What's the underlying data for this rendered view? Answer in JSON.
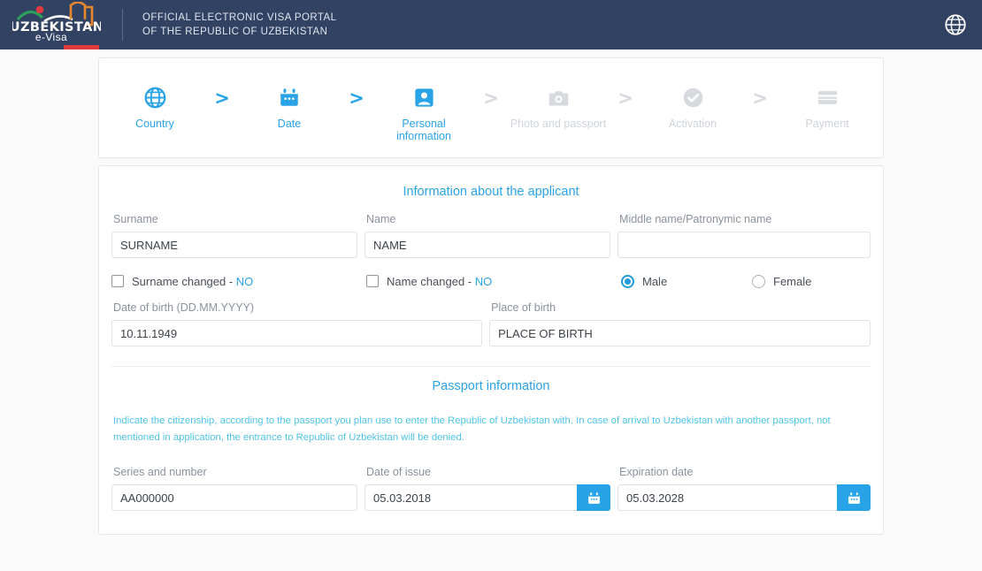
{
  "header": {
    "logo_text": "UZBEKISTAN",
    "logo_sub": "e-Visa",
    "title_line1": "OFFICIAL ELECTRONIC VISA PORTAL",
    "title_line2": "OF THE REPUBLIC OF UZBEKISTAN",
    "language_icon": "globe-icon",
    "bg_color": "#314263",
    "accent_red": "#e03a40"
  },
  "stepper": {
    "accent_color": "#29a3e8",
    "inactive_color": "#cfd4d9",
    "chevron": ">",
    "steps": [
      {
        "label": "Country",
        "icon": "globe-icon",
        "state": "active"
      },
      {
        "label": "Date",
        "icon": "calendar-icon",
        "state": "active"
      },
      {
        "label": "Personal\ninformation",
        "label_line1": "Personal",
        "label_line2": "information",
        "icon": "person-card-icon",
        "state": "current"
      },
      {
        "label": "Photo and passport",
        "icon": "camera-icon",
        "state": "inactive"
      },
      {
        "label": "Activation",
        "icon": "check-circle-icon",
        "state": "inactive"
      },
      {
        "label": "Payment",
        "icon": "credit-card-icon",
        "state": "inactive"
      }
    ]
  },
  "applicant": {
    "section_title": "Information about the applicant",
    "surname_label": "Surname",
    "surname_value": "SURNAME",
    "name_label": "Name",
    "name_value": "NAME",
    "middle_label": "Middle name/Patronymic name",
    "middle_value": "",
    "middle_placeholder": "",
    "surname_changed_label": "Surname changed - ",
    "surname_changed_value": "NO",
    "name_changed_label": "Name changed - ",
    "name_changed_value": "NO",
    "male_label": "Male",
    "female_label": "Female",
    "gender_selected": "Male",
    "dob_label": "Date of birth (DD.MM.YYYY)",
    "dob_value": "10.11.1949",
    "pob_label": "Place of birth",
    "pob_value": "PLACE OF BIRTH"
  },
  "passport": {
    "section_title": "Passport information",
    "notice": "Indicate the citizenship, according to the passport you plan use to enter the Republic of Uzbekistan with. In case of arrival to Uzbekistan with another passport, not mentioned in application, the entrance to Republic of Uzbekistan will be denied.",
    "series_label": "Series and number",
    "series_value": "AA000000",
    "issue_label": "Date of issue",
    "issue_value": "05.03.2018",
    "expiry_label": "Expiration date",
    "expiry_value": "05.03.2028",
    "calendar_icon": "calendar-icon",
    "calendar_btn_color": "#29a3e8"
  }
}
